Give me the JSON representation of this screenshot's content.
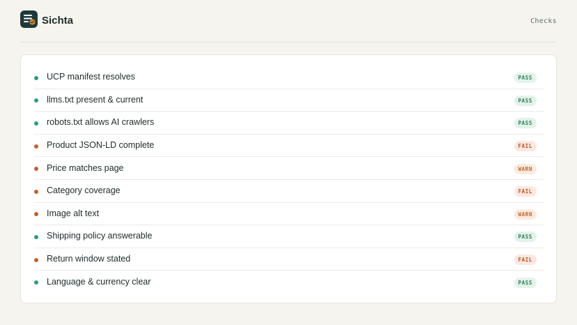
{
  "brand": {
    "name": "Sichta",
    "logo_icon": "list-check-icon"
  },
  "nav": {
    "checks_label": "Checks"
  },
  "colors": {
    "pass": "#2e9e6e",
    "fail": "#c0602e",
    "warn": "#c0602e"
  },
  "checks": [
    {
      "label": "UCP manifest resolves",
      "status": "PASS",
      "kind": "pass"
    },
    {
      "label": "llms.txt present & current",
      "status": "PASS",
      "kind": "pass"
    },
    {
      "label": "robots.txt allows AI crawlers",
      "status": "PASS",
      "kind": "pass"
    },
    {
      "label": "Product JSON-LD complete",
      "status": "FAIL",
      "kind": "fail"
    },
    {
      "label": "Price matches page",
      "status": "WARN",
      "kind": "warn"
    },
    {
      "label": "Category coverage",
      "status": "FAIL",
      "kind": "fail"
    },
    {
      "label": "Image alt text",
      "status": "WARN",
      "kind": "warn"
    },
    {
      "label": "Shipping policy answerable",
      "status": "PASS",
      "kind": "pass"
    },
    {
      "label": "Return window stated",
      "status": "FAIL",
      "kind": "fail"
    },
    {
      "label": "Language & currency clear",
      "status": "PASS",
      "kind": "pass"
    }
  ]
}
